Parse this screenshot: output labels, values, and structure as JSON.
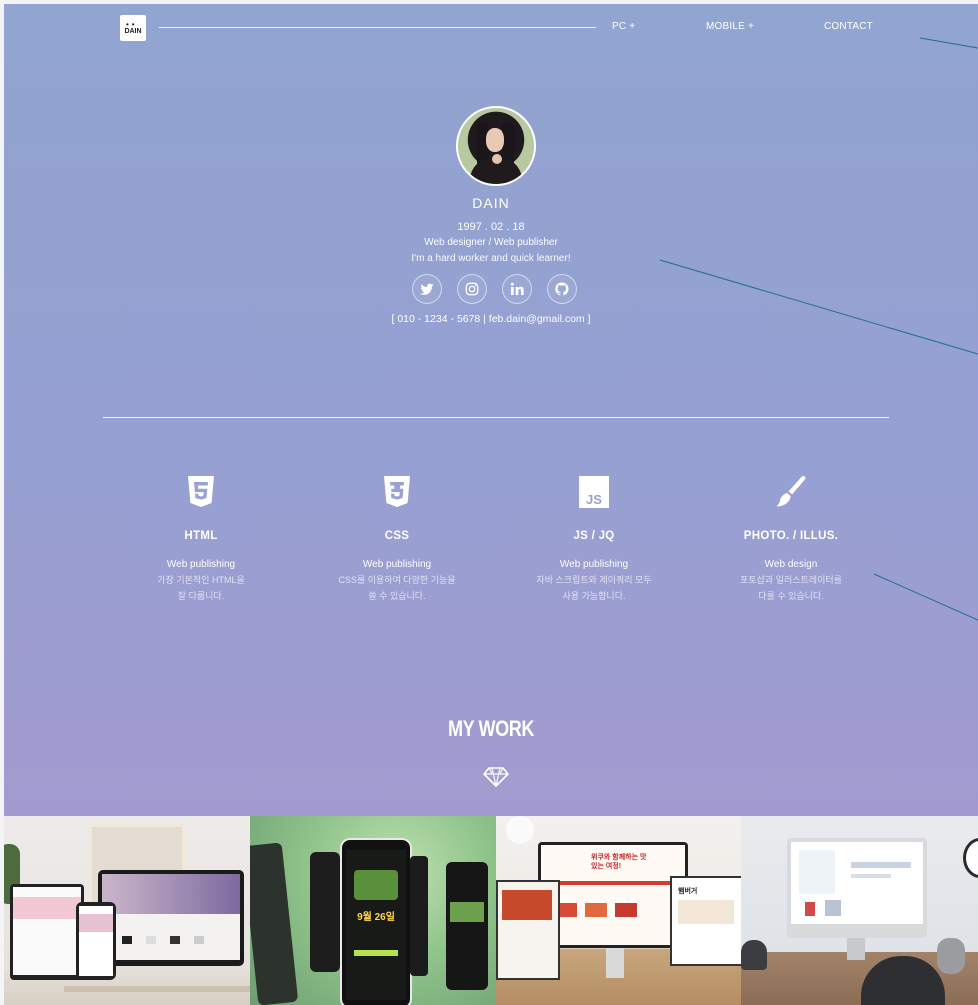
{
  "brand": {
    "logo_dots": "••",
    "logo_text": "DAIN"
  },
  "nav": {
    "items": [
      {
        "label": "PC +"
      },
      {
        "label": "MOBILE +"
      },
      {
        "label": "CONTACT"
      }
    ]
  },
  "profile": {
    "name": "DAIN",
    "dob": "1997 . 02 . 18",
    "role": "Web designer / Web publisher",
    "motto": "I'm a hard worker and quick learner!",
    "contact": "[ 010 - 1234 - 5678  |  feb.dain@gmail.com ]",
    "social_icons": [
      "twitter-icon",
      "instagram-icon",
      "linkedin-icon",
      "github-icon"
    ]
  },
  "skills": [
    {
      "name": "HTML",
      "type": "Web publishing",
      "desc1": "가장 기본적인 HTML을",
      "desc2": "잘 다룹니다.",
      "icon": "html5-icon"
    },
    {
      "name": "CSS",
      "type": "Web publishing",
      "desc1": "CSS를 이용하여 다양한 기능을",
      "desc2": "쓸 수 있습니다.",
      "icon": "css3-icon"
    },
    {
      "name": "JS / JQ",
      "type": "Web publishing",
      "desc1": "자바 스크립트와 제이쿼리 모두",
      "desc2": "사용 가능합니다.",
      "icon": "js-icon"
    },
    {
      "name": "PHOTO. / ILLUS.",
      "type": "Web design",
      "desc1": "포토샵과 일러스트레이터를",
      "desc2": "다룰 수 있습니다.",
      "icon": "brush-icon"
    }
  ],
  "mywork": {
    "title": "MY WORK",
    "icon": "diamond-icon"
  },
  "works_screens": {
    "w2_date": "9월 26일",
    "w3_headline": "위쿠와 함께하는 맛있는 여정!",
    "w3_menu_title": "햄버거"
  },
  "colors": {
    "hero_top": "#92a4d0",
    "hero_bottom": "#a39bcf",
    "accent_line": "#1f6f8f"
  }
}
